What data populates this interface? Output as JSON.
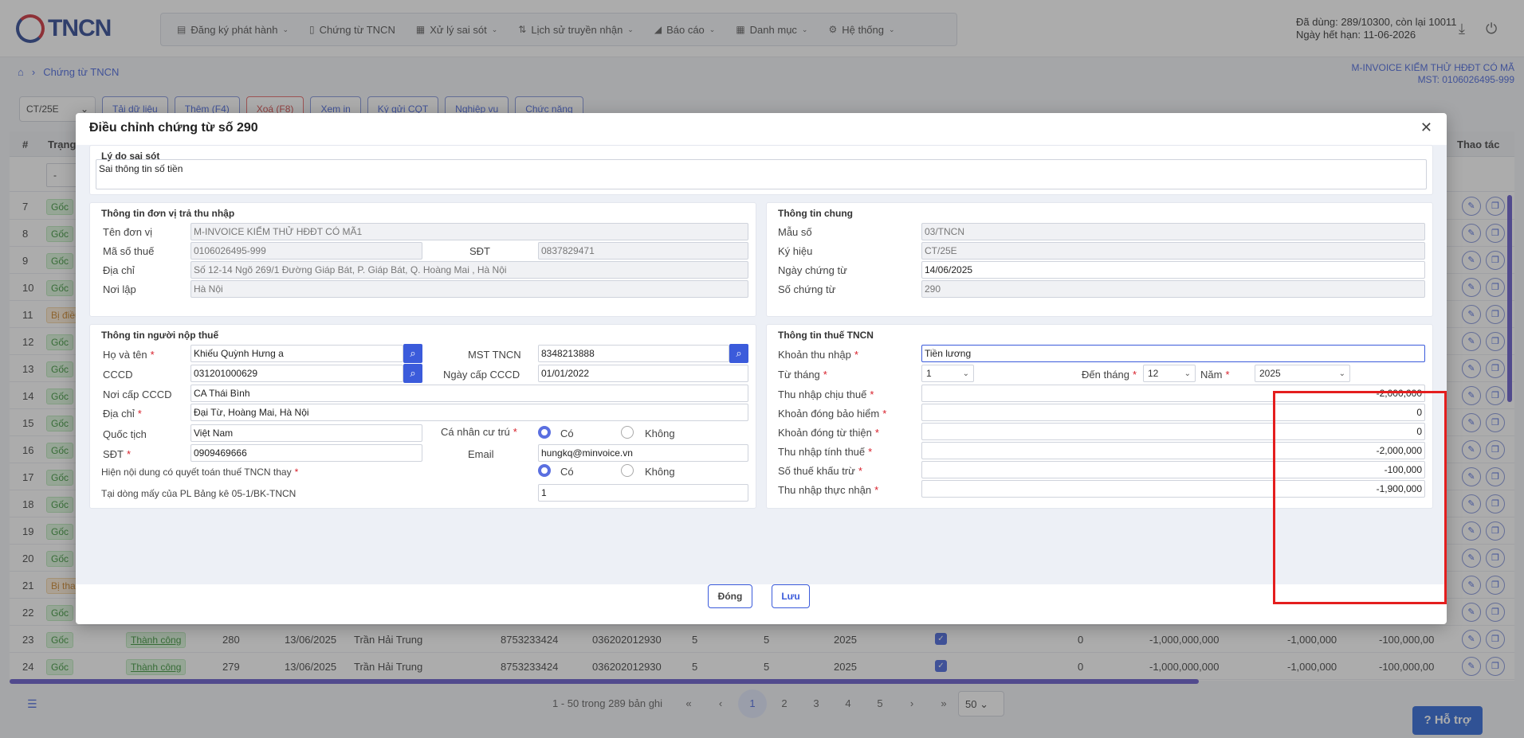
{
  "header": {
    "logo_text": "TNCN",
    "menu": [
      {
        "icon": "file-icon",
        "glyph": "▤",
        "label": "Đăng ký phát hành",
        "chev": true
      },
      {
        "icon": "document-icon",
        "glyph": "▯",
        "label": "Chứng từ TNCN",
        "chev": false
      },
      {
        "icon": "error-icon",
        "glyph": "▦",
        "label": "Xử lý sai sót",
        "chev": true
      },
      {
        "icon": "transfer-icon",
        "glyph": "⇅",
        "label": "Lịch sử truyền nhận",
        "chev": true
      },
      {
        "icon": "chart-icon",
        "glyph": "◢",
        "label": "Báo cáo",
        "chev": true
      },
      {
        "icon": "grid-icon",
        "glyph": "▦",
        "label": "Danh mục",
        "chev": true
      },
      {
        "icon": "gear-icon",
        "glyph": "⚙",
        "label": "Hệ thống",
        "chev": true
      }
    ],
    "usage_line1": "Đã dùng: 289/10300, còn lại 10011",
    "usage_line2": "Ngày hết hạn: 11-06-2026"
  },
  "breadcrumb": {
    "label": "Chứng từ TNCN"
  },
  "company": {
    "name": "M-INVOICE KIỂM THỬ HĐĐT CÓ MÃ",
    "mst": "MST: 0106026495-999"
  },
  "toolbar": {
    "series": "CT/25E",
    "buttons": [
      "Tải dữ liệu",
      "Thêm (F4)",
      "Xoá (F8)",
      "Xem in",
      "Ký gửi CQT",
      "Nghiệp vụ",
      "Chức năng"
    ]
  },
  "table": {
    "col_no": "#",
    "col_status": "Trạng",
    "col_actions": "Thao tác",
    "filter_placeholder": "-",
    "rows": [
      {
        "no": "7",
        "badge": "Gốc",
        "warn": false
      },
      {
        "no": "8",
        "badge": "Gốc",
        "warn": false
      },
      {
        "no": "9",
        "badge": "Gốc",
        "warn": false
      },
      {
        "no": "10",
        "badge": "Gốc",
        "warn": false
      },
      {
        "no": "11",
        "badge": "Bị điều",
        "warn": true
      },
      {
        "no": "12",
        "badge": "Gốc",
        "warn": false
      },
      {
        "no": "13",
        "badge": "Gốc",
        "warn": false
      },
      {
        "no": "14",
        "badge": "Gốc",
        "warn": false
      },
      {
        "no": "15",
        "badge": "Gốc",
        "warn": false
      },
      {
        "no": "16",
        "badge": "Gốc",
        "warn": false
      },
      {
        "no": "17",
        "badge": "Gốc",
        "warn": false
      },
      {
        "no": "18",
        "badge": "Gốc",
        "warn": false
      },
      {
        "no": "19",
        "badge": "Gốc",
        "warn": false
      },
      {
        "no": "20",
        "badge": "Gốc",
        "warn": false
      },
      {
        "no": "21",
        "badge": "Bị tha",
        "warn": true
      },
      {
        "no": "22",
        "badge": "Gốc",
        "warn": false
      }
    ],
    "full_rows": [
      {
        "no": "23",
        "badge": "Gốc",
        "status": "Thành công",
        "num": "280",
        "date": "13/06/2025",
        "name": "Trần Hải Trung",
        "mst": "8753233424",
        "cccd": "036202012930",
        "from": "5",
        "to": "5",
        "year": "2025",
        "v1": "0",
        "v2": "-1,000,000,000",
        "v3": "-1,000,000",
        "v4": "-100,000,00"
      },
      {
        "no": "24",
        "badge": "Gốc",
        "status": "Thành công",
        "num": "279",
        "date": "13/06/2025",
        "name": "Trần Hải Trung",
        "mst": "8753233424",
        "cccd": "036202012930",
        "from": "5",
        "to": "5",
        "year": "2025",
        "v1": "0",
        "v2": "-1,000,000,000",
        "v3": "-1,000,000",
        "v4": "-100,000,00"
      }
    ]
  },
  "footer": {
    "info": "1 - 50 trong 289 bản ghi",
    "pages": [
      "«",
      "‹",
      "1",
      "2",
      "3",
      "4",
      "5",
      "›",
      "»"
    ],
    "page_size": "50",
    "help": "Hỗ trợ"
  },
  "modal": {
    "title": "Điều chỉnh chứng từ số 290",
    "reason": {
      "title": "Lý do sai sót",
      "value": "Sai thông tin số tiền"
    },
    "payer": {
      "title": "Thông tin đơn vị trả thu nhập",
      "name_label": "Tên đơn vị",
      "name": "M-INVOICE KIỂM THỬ HĐĐT CÓ MÃ1",
      "tax_label": "Mã số thuế",
      "tax": "0106026495-999",
      "phone_label": "SĐT",
      "phone": "0837829471",
      "addr_label": "Địa chỉ",
      "addr": "Số 12-14 Ngõ 269/1 Đường Giáp Bát, P. Giáp Bát, Q. Hoàng Mai , Hà Nội",
      "place_label": "Nơi lập",
      "place": "Hà Nội"
    },
    "general": {
      "title": "Thông tin chung",
      "form_label": "Mẫu số",
      "form": "03/TNCN",
      "symbol_label": "Ký hiệu",
      "symbol": "CT/25E",
      "date_label": "Ngày chứng từ",
      "date": "14/06/2025",
      "number_label": "Số chứng từ",
      "number": "290"
    },
    "taxpayer": {
      "title": "Thông tin người nộp thuế",
      "name_label": "Họ và tên",
      "name": "Khiếu Quỳnh Hưng a",
      "mst_label": "MST TNCN",
      "mst": "8348213888",
      "cccd_label": "CCCD",
      "cccd": "031201000629",
      "cccd_date_label": "Ngày cấp CCCD",
      "cccd_date": "01/01/2022",
      "cccd_place_label": "Nơi cấp CCCD",
      "cccd_place": "CA Thái Bình",
      "addr_label": "Địa chỉ",
      "addr": "Đại Từ, Hoàng Mai, Hà Nội",
      "nation_label": "Quốc tịch",
      "nation": "Việt Nam",
      "resident_label": "Cá nhân cư trú",
      "phone_label": "SĐT",
      "phone": "0909469666",
      "email_label": "Email",
      "email": "hungkq@minvoice.vn",
      "settle_label": "Hiện nội dung có quyết toán thuế TNCN thay",
      "row_label": "Tại dòng mấy của PL Bảng kê 05-1/BK-TNCN",
      "row": "1",
      "yes": "Có",
      "no": "Không"
    },
    "tax": {
      "title": "Thông tin thuế TNCN",
      "income_type_label": "Khoản thu nhập",
      "income_type": "Tiền lương",
      "from_label": "Từ tháng",
      "from": "1",
      "to_label": "Đến tháng",
      "to": "12",
      "year_label": "Năm",
      "year": "2025",
      "taxable_label": "Thu nhập chịu thuế",
      "taxable": "-2,000,000",
      "insurance_label": "Khoản đóng bảo hiểm",
      "insurance": "0",
      "charity_label": "Khoản đóng từ thiện",
      "charity": "0",
      "assessable_label": "Thu nhập tính thuế",
      "assessable": "-2,000,000",
      "withheld_label": "Số thuế khấu trừ",
      "withheld": "-100,000",
      "net_label": "Thu nhập thực nhận",
      "net": "-1,900,000"
    },
    "close_label": "Đóng",
    "save_label": "Lưu"
  }
}
